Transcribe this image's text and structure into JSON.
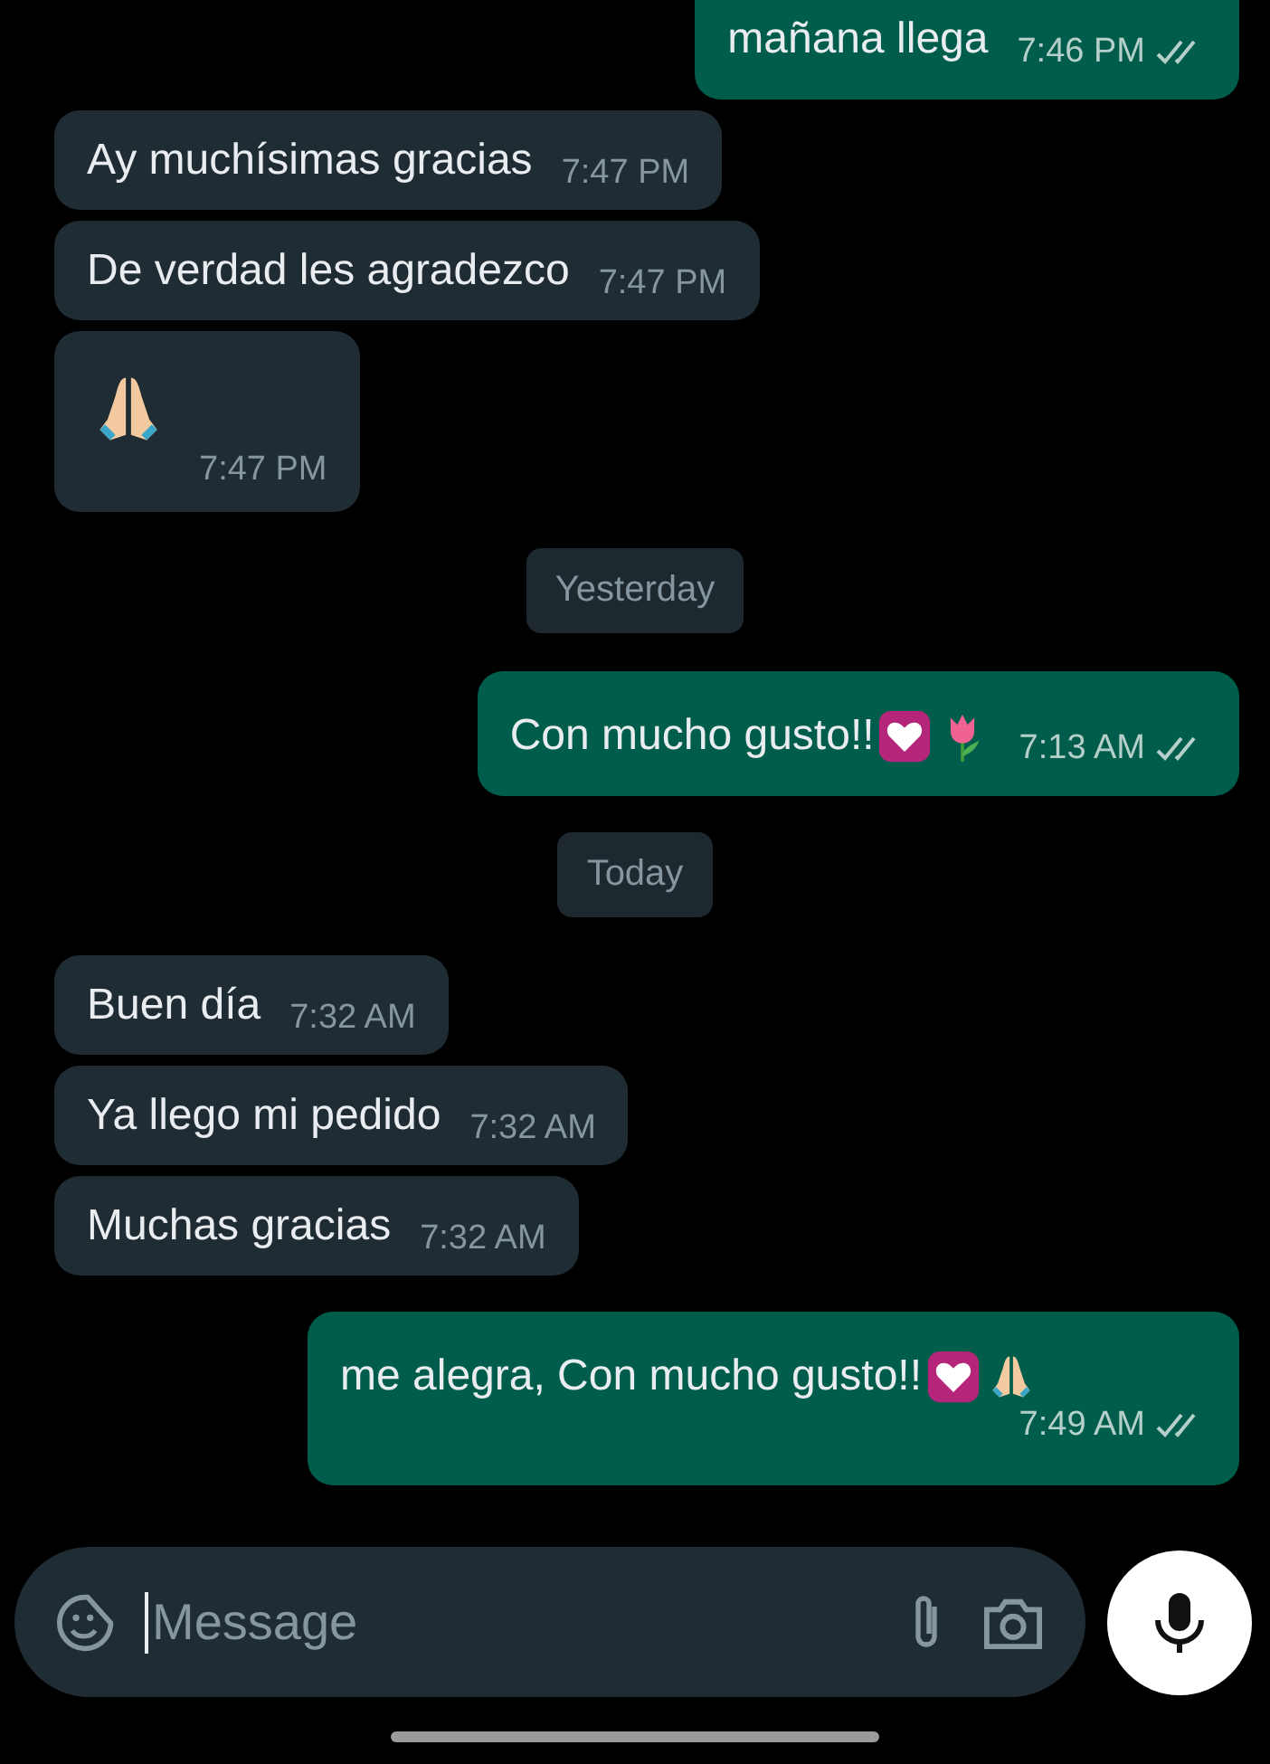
{
  "messages": [
    {
      "kind": "message",
      "outgoing": true,
      "text": "mañana llega",
      "time": "7:46 PM",
      "read": false
    },
    {
      "kind": "message",
      "outgoing": false,
      "text": "Ay muchísimas gracias",
      "time": "7:47 PM"
    },
    {
      "kind": "message",
      "outgoing": false,
      "text": "De verdad les agradezco",
      "time": "7:47 PM"
    },
    {
      "kind": "message",
      "outgoing": false,
      "time": "7:47 PM",
      "emoji": [
        {
          "kind": "praying"
        }
      ]
    },
    {
      "kind": "date",
      "text": "Yesterday"
    },
    {
      "kind": "message",
      "outgoing": true,
      "text": "Con mucho gusto!!",
      "time": "7:13 AM",
      "read": false,
      "emoji": [
        {
          "kind": "heart"
        },
        {
          "kind": "tulip"
        }
      ]
    },
    {
      "kind": "date",
      "text": "Today"
    },
    {
      "kind": "message",
      "outgoing": false,
      "text": "Buen día",
      "time": "7:32 AM"
    },
    {
      "kind": "message",
      "outgoing": false,
      "text": "Ya llego mi pedido",
      "time": "7:32 AM"
    },
    {
      "kind": "message",
      "outgoing": false,
      "text": "Muchas gracias",
      "time": "7:32 AM"
    },
    {
      "kind": "message",
      "outgoing": true,
      "text": "me alegra, Con mucho gusto!!",
      "time": "7:49 AM",
      "read": false,
      "emoji": [
        {
          "kind": "heart"
        },
        {
          "kind": "praying"
        }
      ]
    }
  ],
  "composer": {
    "placeholder": "Message"
  }
}
